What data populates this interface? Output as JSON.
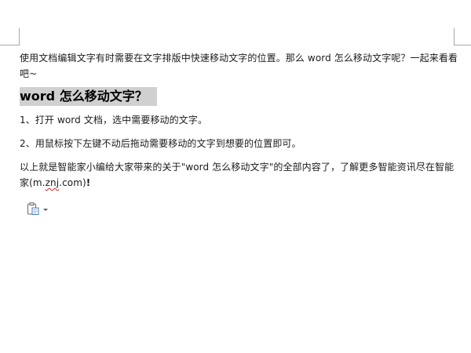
{
  "document": {
    "intro": "使用文档编辑文字有时需要在文字排版中快速移动文字的位置。那么 word 怎么移动文字呢？一起来看看吧~",
    "heading": "word 怎么移动文字？",
    "step1": "1、打开 word 文档，选中需要移动的文字。",
    "step2": "2、用鼠标按下左键不动后拖动需要移动的文字到想要的位置即可。",
    "closing_main": "以上就是智能家小编给大家带来的关于\"word 怎么移动文字\"的全部内容了，了解更多智能资讯尽在智能家",
    "closing_open": "(m.",
    "closing_misspelled": "znj",
    "closing_tail": ".com)",
    "closing_end": "!"
  },
  "paste_options": {
    "icon": "clipboard-paste-icon",
    "dropdown_icon": "chevron-down-icon"
  },
  "colors": {
    "heading_highlight": "#d0d0d0",
    "spellcheck_underline": "#e02020",
    "crop_marks": "#a8a8a8"
  }
}
